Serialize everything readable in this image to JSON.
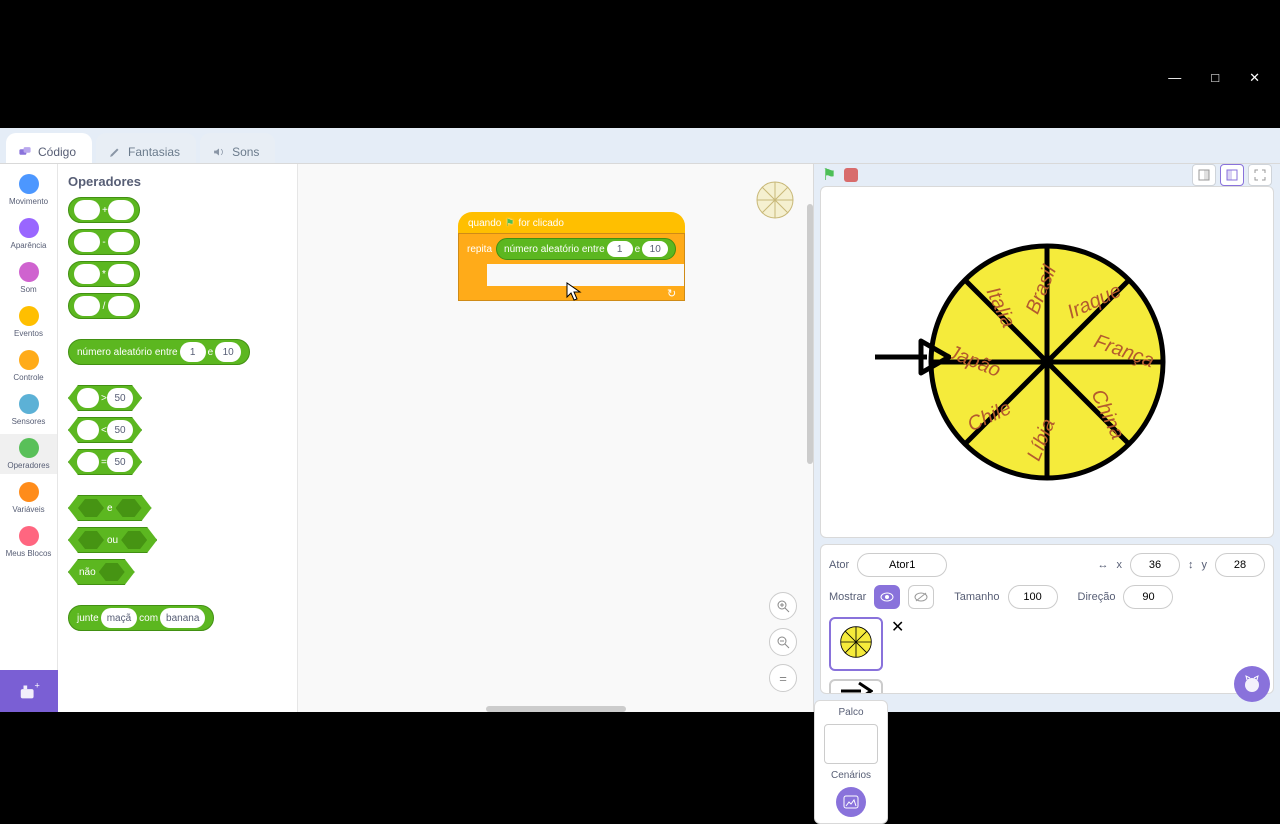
{
  "window_controls": {
    "min": "—",
    "max": "□",
    "close": "✕"
  },
  "tabs": {
    "code": "Código",
    "costumes": "Fantasias",
    "sounds": "Sons"
  },
  "categories": [
    {
      "name": "Movimento",
      "color": "#4c97ff"
    },
    {
      "name": "Aparência",
      "color": "#9966ff"
    },
    {
      "name": "Som",
      "color": "#cf63cf"
    },
    {
      "name": "Eventos",
      "color": "#ffbf00"
    },
    {
      "name": "Controle",
      "color": "#ffab19"
    },
    {
      "name": "Sensores",
      "color": "#5cb1d6"
    },
    {
      "name": "Operadores",
      "color": "#59c059"
    },
    {
      "name": "Variáveis",
      "color": "#ff8c1a"
    },
    {
      "name": "Meus Blocos",
      "color": "#ff6680"
    }
  ],
  "palette_title": "Operadores",
  "op_symbols": {
    "add": "+",
    "sub": "-",
    "mul": "*",
    "div": "/"
  },
  "random": {
    "label": "número aleatório entre",
    "arg1": "1",
    "mid": "e",
    "arg2": "10"
  },
  "cmp": {
    "gt": ">",
    "lt": "<",
    "eq": "=",
    "val": "50"
  },
  "bool": {
    "and": "e",
    "or": "ou",
    "not": "não"
  },
  "join": {
    "label": "junte",
    "a": "maçã",
    "mid": "com",
    "b": "banana"
  },
  "script": {
    "hat": "quando",
    "hat2": "for clicado",
    "repeat": "repita"
  },
  "zoom": {
    "in": "+",
    "out": "−",
    "eq": "="
  },
  "stage_header": {
    "flag": "⚑",
    "stop": "",
    "small": "◻",
    "med": "◧",
    "full": "⛶"
  },
  "wheel": {
    "a": "Brasil",
    "b": "Iraque",
    "c": "França",
    "d": "China",
    "e": "Líbia",
    "f": "Chile",
    "g": "Japão",
    "h": "Italia"
  },
  "sprite": {
    "label_ator": "Ator",
    "name": "Ator1",
    "x_lbl": "x",
    "x": "36",
    "y_lbl": "y",
    "y": "28",
    "show": "Mostrar",
    "size_lbl": "Tamanho",
    "size": "100",
    "dir_lbl": "Direção",
    "dir": "90"
  },
  "stage_panel": {
    "title": "Palco",
    "backdrops": "Cenários"
  }
}
